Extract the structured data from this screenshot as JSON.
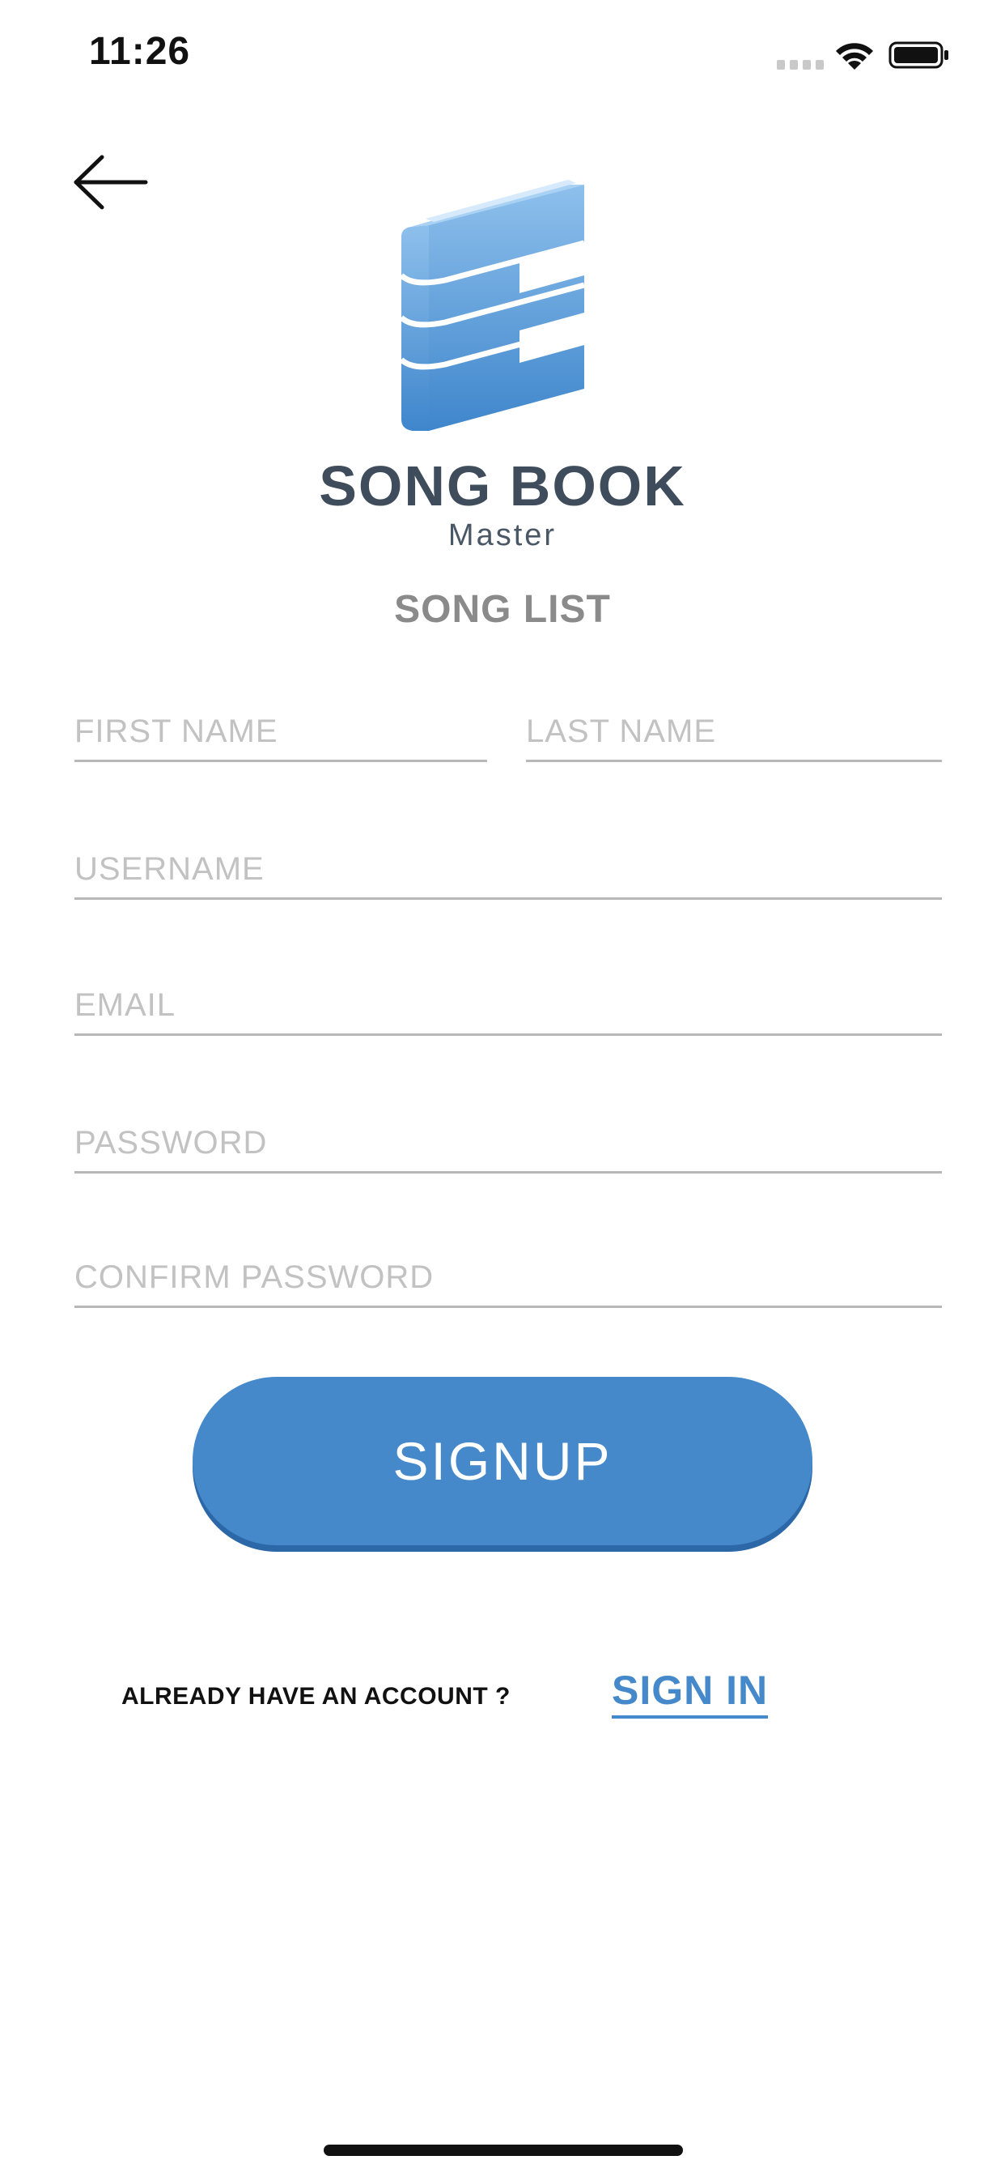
{
  "status_bar": {
    "time": "11:26"
  },
  "brand": {
    "title": "SONG BOOK",
    "subtitle": "Master",
    "logo_icon": "book-logo-icon"
  },
  "section_title": "SONG LIST",
  "form": {
    "first_name_placeholder": "FIRST NAME",
    "last_name_placeholder": "LAST NAME",
    "username_placeholder": "USERNAME",
    "email_placeholder": "EMAIL",
    "password_placeholder": "PASSWORD",
    "confirm_password_placeholder": "CONFIRM PASSWORD",
    "signup_label": "SIGNUP"
  },
  "footer": {
    "prompt": "ALREADY HAVE AN ACCOUNT ?",
    "signin_label": "SIGN IN"
  },
  "colors": {
    "accent": "#4589cb",
    "brand_text": "#3e4c5c",
    "placeholder": "#c2c2c2"
  }
}
